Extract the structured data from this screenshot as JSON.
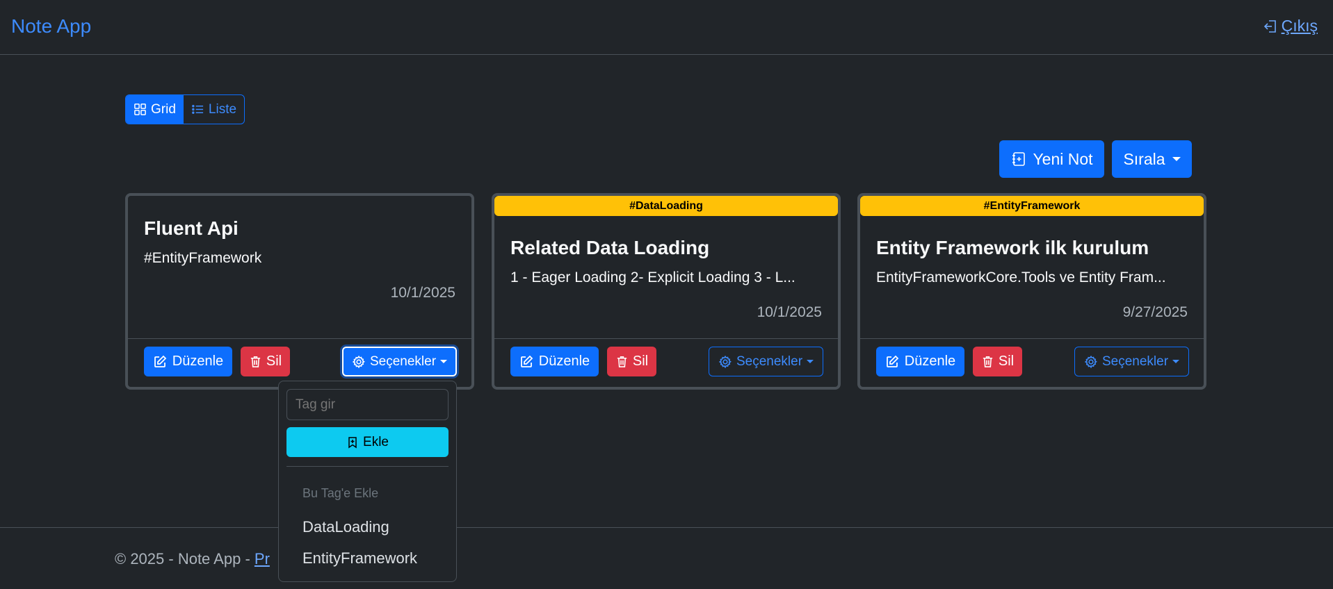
{
  "navbar": {
    "brand": "Note App",
    "logout_label": "Çıkış"
  },
  "view_toggle": {
    "grid_label": "Grid",
    "list_label": "Liste",
    "active": "grid"
  },
  "actions": {
    "new_note_label": "Yeni Not",
    "sort_label": "Sırala"
  },
  "cards": [
    {
      "tag": "",
      "title": "Fluent Api",
      "text": "#EntityFramework",
      "date": "10/1/2025",
      "edit_label": "Düzenle",
      "delete_label": "Sil",
      "options_label": "Seçenekler"
    },
    {
      "tag": "#DataLoading",
      "title": "Related Data Loading",
      "text": "1 - Eager Loading 2- Explicit Loading 3 - L...",
      "date": "10/1/2025",
      "edit_label": "Düzenle",
      "delete_label": "Sil",
      "options_label": "Seçenekler"
    },
    {
      "tag": "#EntityFramework",
      "title": "Entity Framework ilk kurulum",
      "text": "EntityFrameworkCore.Tools ve Entity Fram...",
      "date": "9/27/2025",
      "edit_label": "Düzenle",
      "delete_label": "Sil",
      "options_label": "Seçenekler"
    }
  ],
  "options_dropdown": {
    "input_placeholder": "Tag gir",
    "add_label": "Ekle",
    "header": "Bu Tag'e Ekle",
    "items": [
      "DataLoading",
      "EntityFramework"
    ]
  },
  "footer": {
    "copyright": "© 2025 - Note App - ",
    "privacy_label": "Pr"
  },
  "colors": {
    "background": "#212529",
    "primary": "#0d6efd",
    "danger": "#dc3545",
    "info": "#0dcaf0",
    "tag": "#ffc107"
  }
}
